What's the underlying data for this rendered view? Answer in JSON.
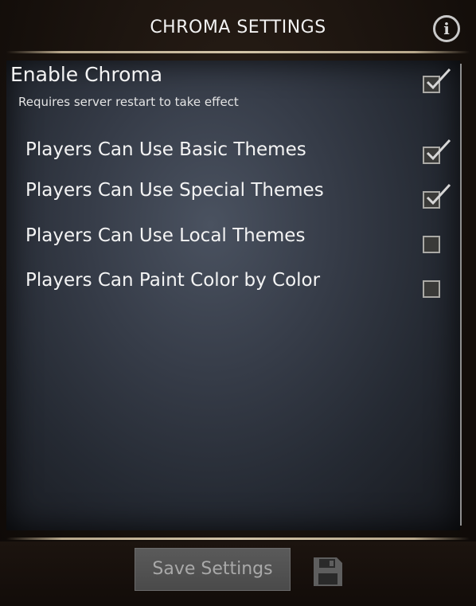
{
  "header": {
    "title": "CHROMA SETTINGS",
    "info_glyph": "i",
    "info_icon": "info-icon"
  },
  "enable": {
    "label": "Enable Chroma",
    "note": "Requires server restart to take effect",
    "checked": true
  },
  "options": [
    {
      "label": "Players Can Use Basic Themes",
      "checked": true
    },
    {
      "label": "Players Can Use Special Themes",
      "checked": true
    },
    {
      "label": "Players Can Use Local Themes",
      "checked": false
    },
    {
      "label": "Players Can Paint Color by Color",
      "checked": false
    }
  ],
  "footer": {
    "save_label": "Save Settings",
    "save_icon": "floppy-disk-icon"
  },
  "colors": {
    "accent_divider": "#d2c4a8",
    "panel": "#363c48",
    "text": "#f4f4f4"
  }
}
